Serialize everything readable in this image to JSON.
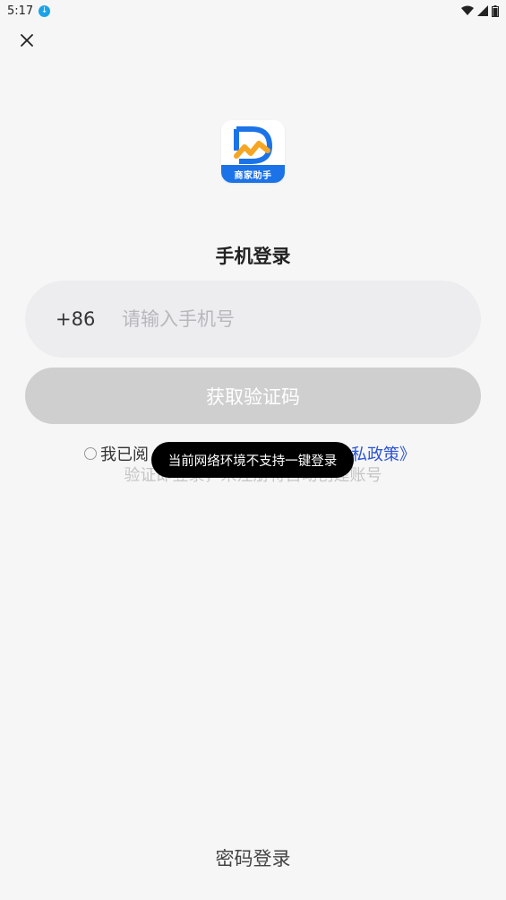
{
  "status_bar": {
    "time": "5:17"
  },
  "logo": {
    "label": "商家助手"
  },
  "title": "手机登录",
  "phone": {
    "country_code": "+86",
    "placeholder": "请输入手机号",
    "value": ""
  },
  "code_button": {
    "label": "获取验证码",
    "enabled": false
  },
  "agreement": {
    "prefix": "我已阅",
    "link": "隐私政策》",
    "note": "验证即登录，未注册将自动创建账号",
    "checked": false
  },
  "toast": "当前网络环境不支持一键登录",
  "password_login": "密码登录",
  "colors": {
    "background": "#f6f6f6",
    "field": "#ededf0",
    "button_disabled": "#cfcfcf",
    "link": "#2a52d8",
    "brand_blue": "#1c73e8",
    "brand_orange": "#f5a623"
  }
}
